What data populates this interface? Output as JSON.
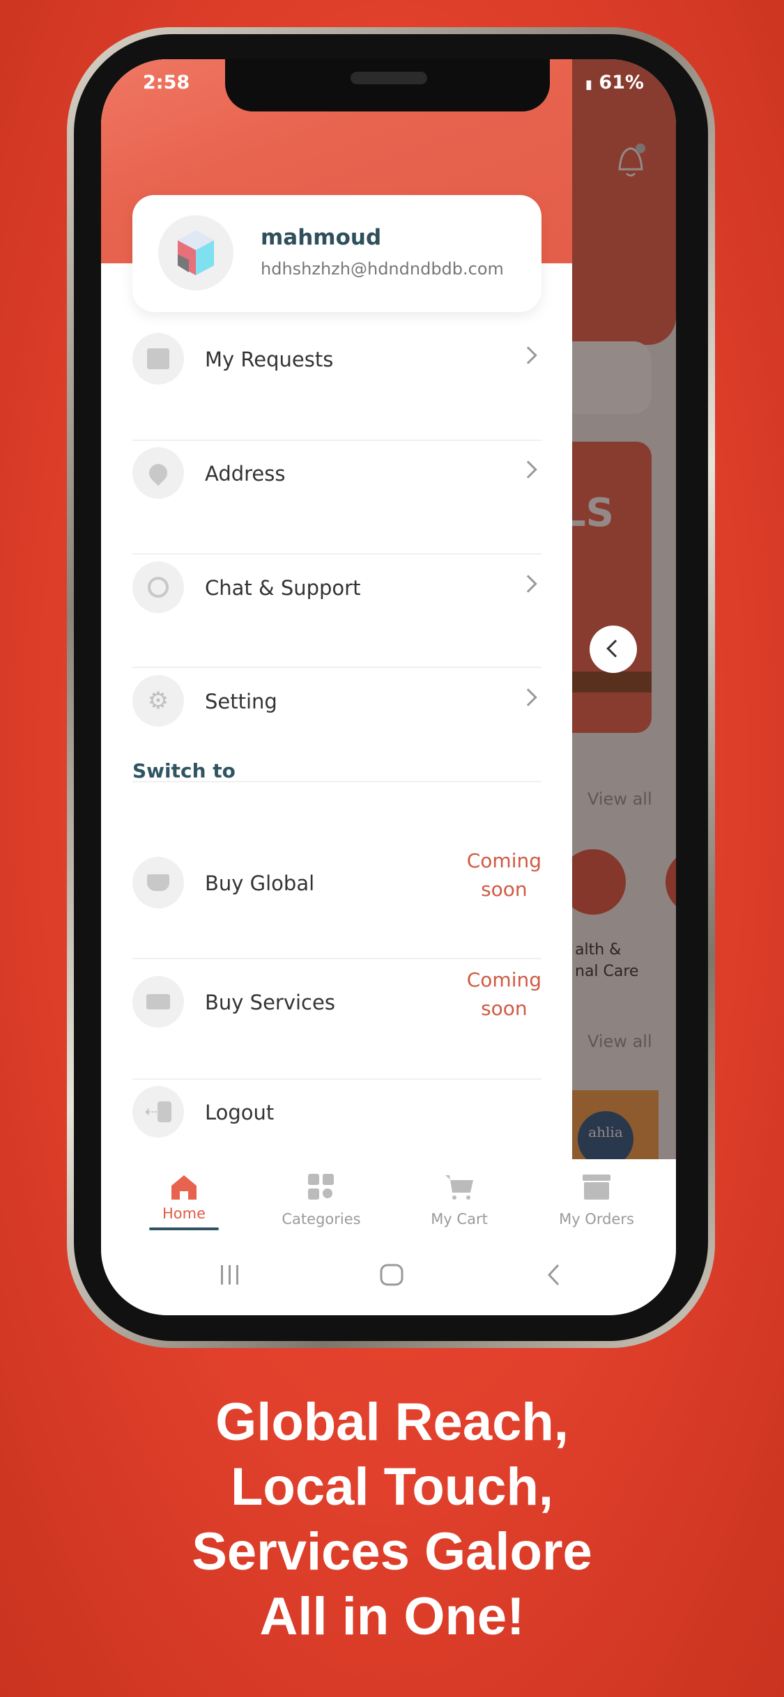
{
  "status_bar": {
    "time": "2:58",
    "battery": "61%"
  },
  "profile": {
    "name": "mahmoud",
    "email": "hdhshzhzh@hdndndbdb.com"
  },
  "menu": [
    {
      "label": "My Requests",
      "icon": "box-icon"
    },
    {
      "label": "Address",
      "icon": "location-icon"
    },
    {
      "label": "Chat & Support",
      "icon": "chat-icon"
    },
    {
      "label": "Setting",
      "icon": "gear-icon"
    }
  ],
  "switch_to": {
    "title": "Switch to",
    "items": [
      {
        "label": "Buy Global",
        "badge_line1": "Coming",
        "badge_line2": "soon",
        "icon": "ship-icon"
      },
      {
        "label": "Buy Services",
        "badge_line1": "Coming",
        "badge_line2": "soon",
        "icon": "delivery-icon"
      }
    ]
  },
  "logout": "Logout",
  "background_home": {
    "view_all_1": "View all",
    "view_all_2": "View all",
    "category_line1": "alth &",
    "category_line2": "nal Care",
    "banner_text": "LS",
    "brand": "ahlia"
  },
  "bottom_nav": [
    {
      "label": "Home",
      "active": true
    },
    {
      "label": "Categories"
    },
    {
      "label": "My Cart"
    },
    {
      "label": "My Orders"
    }
  ],
  "caption": [
    "Global Reach,",
    "Local Touch,",
    "Services Galore",
    "All in One!"
  ],
  "colors": {
    "accent": "#e8634e",
    "text_dark": "#2f4f5c",
    "coming_soon": "#d05a44",
    "background": "#e0402c"
  }
}
